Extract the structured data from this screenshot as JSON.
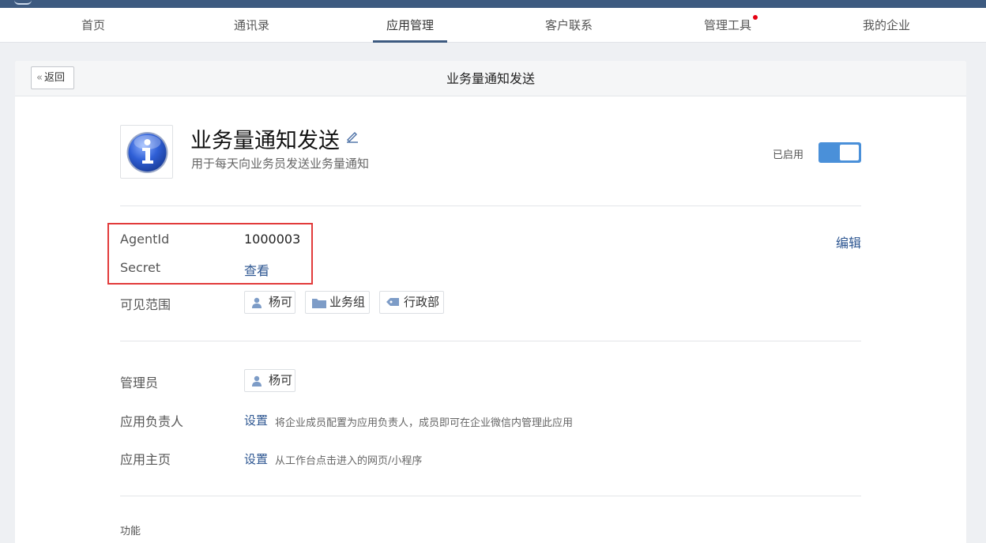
{
  "nav": {
    "items": [
      {
        "label": "首页"
      },
      {
        "label": "通讯录"
      },
      {
        "label": "应用管理"
      },
      {
        "label": "客户联系"
      },
      {
        "label": "管理工具"
      },
      {
        "label": "我的企业"
      }
    ],
    "active_label": "应用管理",
    "notification_label": "管理工具"
  },
  "header": {
    "back_label": "返回",
    "title": "业务量通知发送"
  },
  "app": {
    "name": "业务量通知发送",
    "description": "用于每天向业务员发送业务量通知",
    "icon": "info-icon",
    "status_label": "已启用",
    "enabled": true
  },
  "details": {
    "agent_id_label": "AgentId",
    "agent_id_value": "1000003",
    "secret_label": "Secret",
    "secret_action": "查看",
    "edit_label": "编辑",
    "visible_range_label": "可见范围",
    "visible_range": [
      {
        "type": "user",
        "icon": "user-icon",
        "label": "杨可"
      },
      {
        "type": "group",
        "icon": "folder-icon",
        "label": "业务组"
      },
      {
        "type": "department",
        "icon": "tag-icon",
        "label": "行政部"
      }
    ]
  },
  "management": {
    "admin_label": "管理员",
    "admin_value": "杨可",
    "owner_label": "应用负责人",
    "owner_action": "设置",
    "owner_hint": "将企业成员配置为应用负责人，成员即可在企业微信内管理此应用",
    "homepage_label": "应用主页",
    "homepage_action": "设置",
    "homepage_hint": "从工作台点击进入的网页/小程序"
  },
  "features": {
    "label": "功能"
  },
  "colors": {
    "brand": "#3d5a80",
    "link": "#2d5691",
    "toggle_on": "#4a90d9",
    "highlight": "#e23b3b",
    "notification_dot": "#e60012"
  }
}
